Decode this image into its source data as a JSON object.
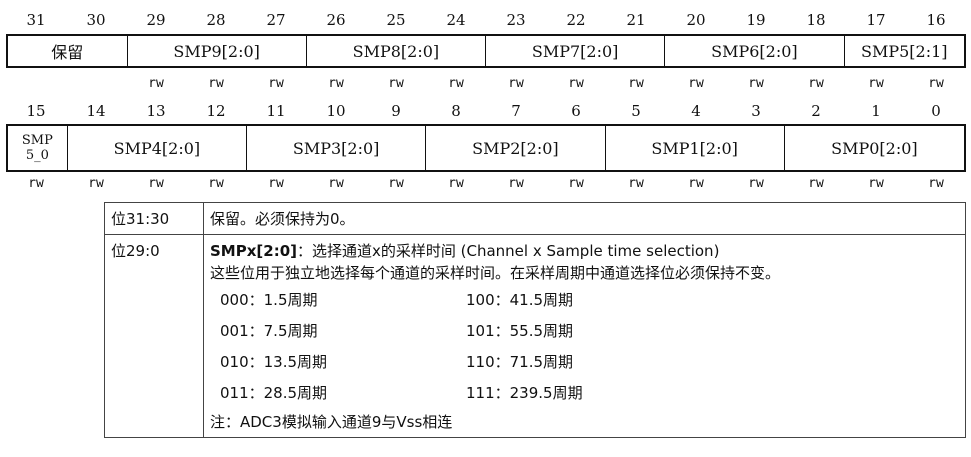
{
  "bits_high": [
    "31",
    "30",
    "29",
    "28",
    "27",
    "26",
    "25",
    "24",
    "23",
    "22",
    "21",
    "20",
    "19",
    "18",
    "17",
    "16"
  ],
  "bits_low": [
    "15",
    "14",
    "13",
    "12",
    "11",
    "10",
    "9",
    "8",
    "7",
    "6",
    "5",
    "4",
    "3",
    "2",
    "1",
    "0"
  ],
  "fields_high": [
    {
      "label": "保留",
      "span": 2
    },
    {
      "label": "SMP9[2:0]",
      "span": 3
    },
    {
      "label": "SMP8[2:0]",
      "span": 3
    },
    {
      "label": "SMP7[2:0]",
      "span": 3
    },
    {
      "label": "SMP6[2:0]",
      "span": 3
    },
    {
      "label": "SMP5[2:1]",
      "span": 2
    }
  ],
  "fields_low": [
    {
      "label_top": "SMP",
      "label_bottom": "5_0",
      "span": 1
    },
    {
      "label": "SMP4[2:0]",
      "span": 3
    },
    {
      "label": "SMP3[2:0]",
      "span": 3
    },
    {
      "label": "SMP2[2:0]",
      "span": 3
    },
    {
      "label": "SMP1[2:0]",
      "span": 3
    },
    {
      "label": "SMP0[2:0]",
      "span": 3
    }
  ],
  "access_high": [
    "",
    "",
    "rw",
    "rw",
    "rw",
    "rw",
    "rw",
    "rw",
    "rw",
    "rw",
    "rw",
    "rw",
    "rw",
    "rw",
    "rw",
    "rw"
  ],
  "access_low": [
    "rw",
    "rw",
    "rw",
    "rw",
    "rw",
    "rw",
    "rw",
    "rw",
    "rw",
    "rw",
    "rw",
    "rw",
    "rw",
    "rw",
    "rw",
    "rw"
  ],
  "desc": {
    "row1": {
      "bits": "位31:30",
      "text": "保留。必须保持为0。"
    },
    "row2": {
      "bits": "位29:0",
      "name": "SMPx[2:0]",
      "title": "：选择通道x的采样时间 (Channel x Sample time selection)",
      "line2": "这些位用于独立地选择每个通道的采样时间。在采样周期中通道选择位必须保持不变。",
      "cycles": [
        "000：1.5周期",
        "100：41.5周期",
        "001：7.5周期",
        "101：55.5周期",
        "010：13.5周期",
        "110：71.5周期",
        "011：28.5周期",
        "111：239.5周期"
      ],
      "note": "注：ADC3模拟输入通道9与Vss相连"
    }
  }
}
